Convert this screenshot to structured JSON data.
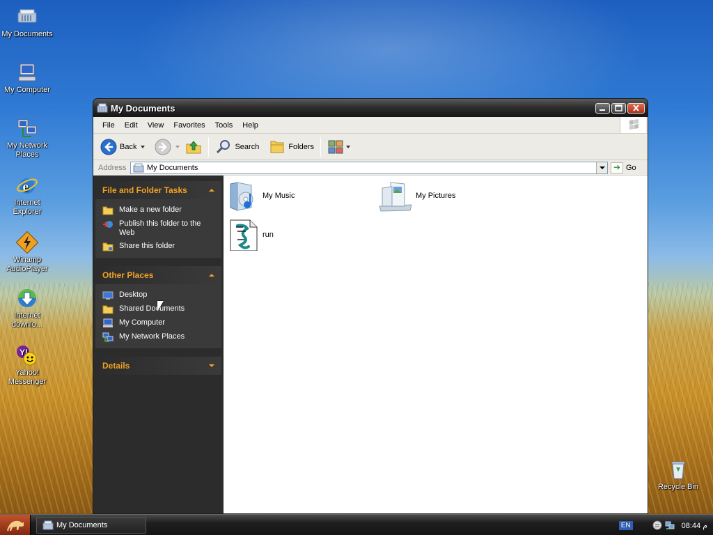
{
  "desktop": {
    "icons": [
      {
        "label": "My Documents",
        "icon": "my-documents-icon"
      },
      {
        "label": "My Computer",
        "icon": "my-computer-icon"
      },
      {
        "label": "My Network Places",
        "icon": "network-places-icon"
      },
      {
        "label": "Internet Explorer",
        "icon": "internet-explorer-icon"
      },
      {
        "label": "Winamp AudioPlayer",
        "icon": "winamp-icon"
      },
      {
        "label": "Internet downlo...",
        "icon": "download-manager-icon"
      },
      {
        "label": "Yahoo! Messenger",
        "icon": "yahoo-messenger-icon"
      },
      {
        "label": "Recycle Bin",
        "icon": "recycle-bin-icon"
      }
    ]
  },
  "window": {
    "title": "My Documents",
    "menu": [
      "File",
      "Edit",
      "View",
      "Favorites",
      "Tools",
      "Help"
    ],
    "toolbar": {
      "back": "Back",
      "search": "Search",
      "folders": "Folders"
    },
    "address": {
      "label": "Address",
      "value": "My Documents",
      "go": "Go"
    },
    "taskpane": {
      "file_tasks": {
        "title": "File and Folder Tasks",
        "items": [
          "Make a new folder",
          "Publish this folder to the Web",
          "Share this folder"
        ]
      },
      "other_places": {
        "title": "Other Places",
        "items": [
          "Desktop",
          "Shared Documents",
          "My Computer",
          "My Network Places"
        ]
      },
      "details": {
        "title": "Details"
      }
    },
    "files": [
      {
        "name": "My Music",
        "icon": "music-folder-icon"
      },
      {
        "name": "My Pictures",
        "icon": "pictures-folder-icon"
      },
      {
        "name": "run",
        "icon": "script-file-icon"
      }
    ]
  },
  "taskbar": {
    "active_window": "My Documents",
    "language": "EN",
    "clock": "08:44 م"
  },
  "colors": {
    "pane_heading": "#f0a224",
    "taskpane_bg": "#2c2c2c"
  }
}
